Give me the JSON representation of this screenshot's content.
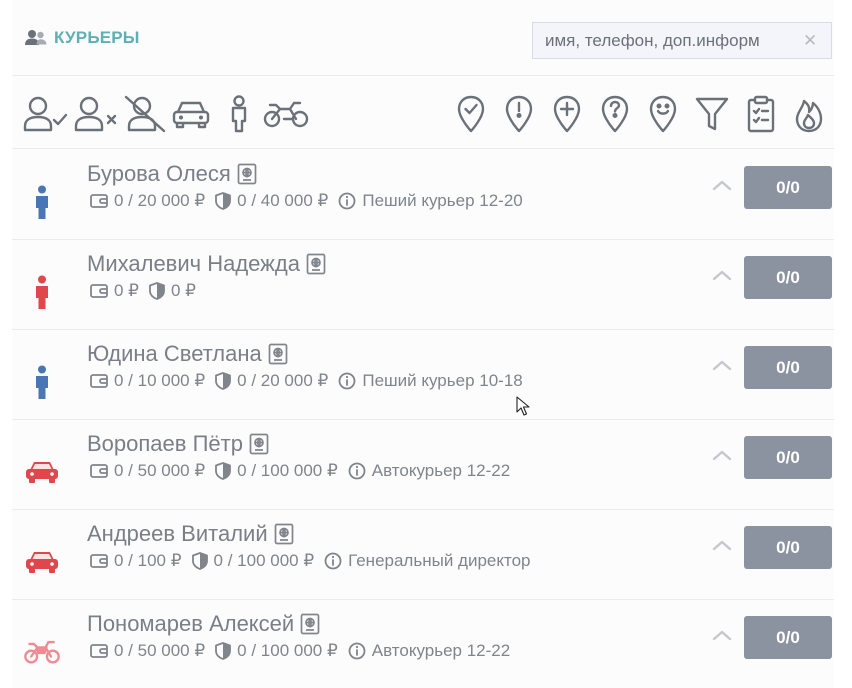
{
  "header": {
    "title": "КУРЬЕРЫ",
    "title_icon": "users-icon",
    "search": {
      "value": "",
      "placeholder": "имя, телефон, доп.информ",
      "clear_symbol": "✕"
    }
  },
  "toolbar": {
    "left_filters": [
      "user-check-icon",
      "user-x-icon",
      "user-off-icon",
      "car-icon",
      "pedestrian-icon",
      "motorcycle-icon"
    ],
    "right_filters": [
      "location-check-icon",
      "location-alert-icon",
      "location-plus-icon",
      "location-question-icon",
      "location-smile-icon",
      "filter-icon",
      "clipboard-list-icon",
      "fire-icon"
    ]
  },
  "couriers": [
    {
      "name": "Бурова Олеся",
      "type_icon": "pedestrian-icon",
      "type_color": "#4a76b5",
      "wallet": "0 / 20 000 ₽",
      "deposit": "0 / 40 000 ₽",
      "info": "Пеший курьер 12-20",
      "count": "0/0"
    },
    {
      "name": "Михалевич Надежда",
      "type_icon": "pedestrian-icon",
      "type_color": "#e0474c",
      "wallet": "0 ₽",
      "deposit": "0 ₽",
      "info": "",
      "count": "0/0"
    },
    {
      "name": "Юдина Светлана",
      "type_icon": "pedestrian-icon",
      "type_color": "#4a76b5",
      "wallet": "0 / 10 000 ₽",
      "deposit": "0 / 20 000 ₽",
      "info": "Пеший курьер 10-18",
      "count": "0/0"
    },
    {
      "name": "Воропаев Пётр",
      "type_icon": "car-icon",
      "type_color": "#e0474c",
      "wallet": "0 / 50 000 ₽",
      "deposit": "0 / 100 000 ₽",
      "info": "Автокурьер 12-22",
      "count": "0/0"
    },
    {
      "name": "Андреев Виталий",
      "type_icon": "car-icon",
      "type_color": "#e0474c",
      "wallet": "0 / 100 ₽",
      "deposit": "0 / 100 000 ₽",
      "info": "Генеральный директор",
      "count": "0/0"
    },
    {
      "name": "Пономарев Алексей",
      "type_icon": "motorcycle-icon",
      "type_color": "#f08a93",
      "wallet": "0 / 50 000 ₽",
      "deposit": "0 / 100 000 ₽",
      "info": "Автокурьер 12-22",
      "count": "0/0"
    }
  ]
}
